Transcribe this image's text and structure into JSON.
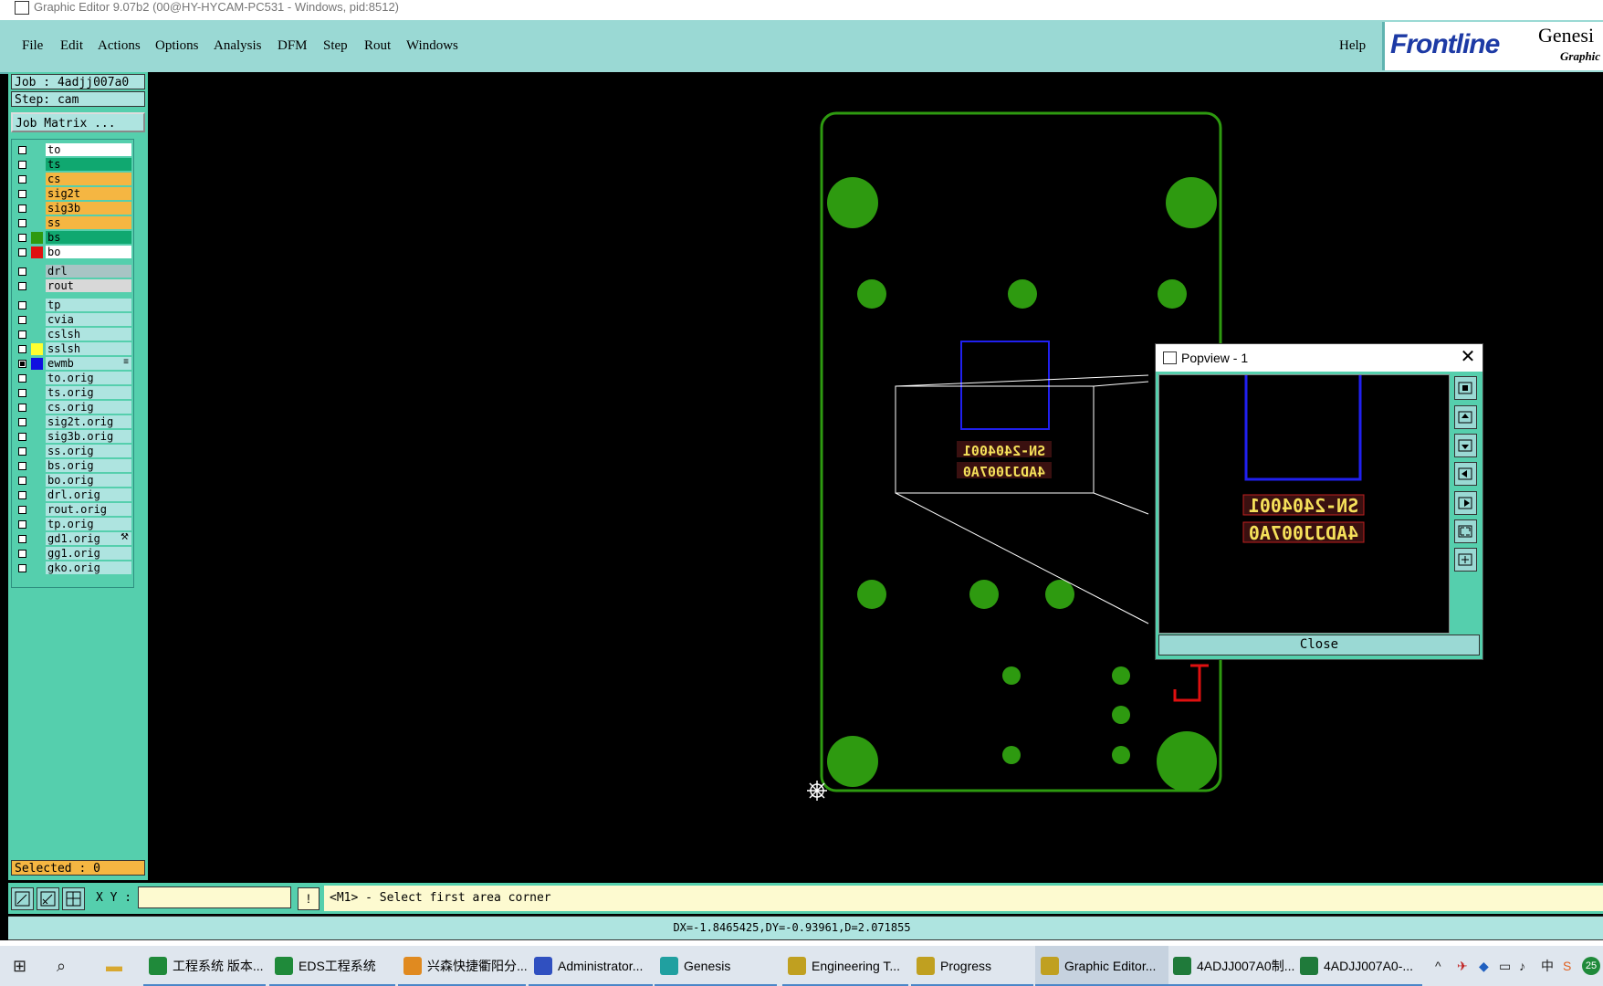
{
  "window": {
    "title": "Graphic Editor 9.07b2 (00@HY-HYCAM-PC531 - Windows, pid:8512)"
  },
  "menu": {
    "items": [
      "File",
      "Edit",
      "Actions",
      "Options",
      "Analysis",
      "DFM",
      "Step",
      "Rout",
      "Windows"
    ],
    "help": "Help"
  },
  "brand": {
    "logo": "Frontline",
    "product": "Genesi",
    "subtitle": "Graphic"
  },
  "job": {
    "job_label": "Job : 4adjj007a0",
    "step_label": "Step: cam",
    "matrix_button": "Job Matrix ..."
  },
  "layers": [
    {
      "name": "to",
      "bg": "#ffffff",
      "swatch": "",
      "checked": false
    },
    {
      "name": "ts",
      "bg": "#10a870",
      "swatch": "",
      "checked": false
    },
    {
      "name": "cs",
      "bg": "#f5b642",
      "swatch": "",
      "checked": false
    },
    {
      "name": "sig2t",
      "bg": "#f5b642",
      "swatch": "",
      "checked": false
    },
    {
      "name": "sig3b",
      "bg": "#f5b642",
      "swatch": "",
      "checked": false
    },
    {
      "name": "ss",
      "bg": "#f5b642",
      "swatch": "",
      "checked": false
    },
    {
      "name": "bs",
      "bg": "#10a870",
      "swatch": "#2e9a10",
      "checked": false
    },
    {
      "name": "bo",
      "bg": "#ffffff",
      "swatch": "#e01010",
      "checked": false
    },
    {
      "name": "drl",
      "bg": "#a8c4c4",
      "swatch": "",
      "checked": false
    },
    {
      "name": "rout",
      "bg": "#d8d8d8",
      "swatch": "",
      "checked": false
    },
    {
      "name": "tp",
      "bg": "#aee4e0",
      "swatch": "",
      "checked": false
    },
    {
      "name": "cvia",
      "bg": "#aee4e0",
      "swatch": "",
      "checked": false
    },
    {
      "name": "cslsh",
      "bg": "#aee4e0",
      "swatch": "",
      "checked": false
    },
    {
      "name": "sslsh",
      "bg": "#aee4e0",
      "swatch": "#ffff30",
      "checked": false
    },
    {
      "name": "ewmb",
      "bg": "#aee4e0",
      "swatch": "#1010e0",
      "checked": true,
      "mark": "≡"
    },
    {
      "name": "to.orig",
      "bg": "#aee4e0",
      "swatch": "",
      "checked": false
    },
    {
      "name": "ts.orig",
      "bg": "#aee4e0",
      "swatch": "",
      "checked": false
    },
    {
      "name": "cs.orig",
      "bg": "#aee4e0",
      "swatch": "",
      "checked": false
    },
    {
      "name": "sig2t.orig",
      "bg": "#aee4e0",
      "swatch": "",
      "checked": false
    },
    {
      "name": "sig3b.orig",
      "bg": "#aee4e0",
      "swatch": "",
      "checked": false
    },
    {
      "name": "ss.orig",
      "bg": "#aee4e0",
      "swatch": "",
      "checked": false
    },
    {
      "name": "bs.orig",
      "bg": "#aee4e0",
      "swatch": "",
      "checked": false
    },
    {
      "name": "bo.orig",
      "bg": "#aee4e0",
      "swatch": "",
      "checked": false
    },
    {
      "name": "drl.orig",
      "bg": "#aee4e0",
      "swatch": "",
      "checked": false
    },
    {
      "name": "rout.orig",
      "bg": "#aee4e0",
      "swatch": "",
      "checked": false
    },
    {
      "name": "tp.orig",
      "bg": "#aee4e0",
      "swatch": "",
      "checked": false
    },
    {
      "name": "gd1.orig",
      "bg": "#aee4e0",
      "swatch": "",
      "checked": false,
      "mark": "⚒"
    },
    {
      "name": "gg1.orig",
      "bg": "#aee4e0",
      "swatch": "",
      "checked": false
    },
    {
      "name": "gko.orig",
      "bg": "#aee4e0",
      "swatch": "",
      "checked": false
    }
  ],
  "selected_label": "Selected : 0",
  "board": {
    "text_line1": "SN-2404001",
    "text_line2": "4ADJJ007A0"
  },
  "popview": {
    "title": "Popview - 1",
    "close_button": "Close",
    "text_line1": "SN-2404001",
    "text_line2": "4ADJJ007A0"
  },
  "command": {
    "xy_label": "X Y :",
    "xy_value": "",
    "exclaim": "!",
    "prompt": "<M1> - Select first area corner"
  },
  "status": {
    "measure": "DX=-1.8465425,DY=-0.93961,D=2.071855"
  },
  "taskbar": {
    "items": [
      {
        "label": "工程系统   版本...",
        "icon": "app-p-icon",
        "color": "#1f8a3a"
      },
      {
        "label": "EDS工程系统",
        "icon": "app-f-icon",
        "color": "#1f8a3a"
      },
      {
        "label": "兴森快捷衢阳分...",
        "icon": "shell-icon",
        "color": "#e08a20"
      },
      {
        "label": "Administrator...",
        "icon": "floppy-icon",
        "color": "#3050c0"
      },
      {
        "label": "Genesis",
        "icon": "genesis-icon",
        "color": "#20a0a0"
      },
      {
        "label": "Engineering T...",
        "icon": "editor-icon",
        "color": "#c0a020"
      },
      {
        "label": "Progress",
        "icon": "editor-icon",
        "color": "#c0a020"
      },
      {
        "label": "Graphic Editor...",
        "icon": "editor-icon",
        "color": "#c0a020",
        "active": true
      },
      {
        "label": "4ADJJ007A0制...",
        "icon": "excel-icon",
        "color": "#1f7a3a"
      },
      {
        "label": "4ADJJ007A0-...",
        "icon": "excel-icon",
        "color": "#1f7a3a"
      }
    ],
    "ime": "中",
    "clock_badge": "25"
  }
}
